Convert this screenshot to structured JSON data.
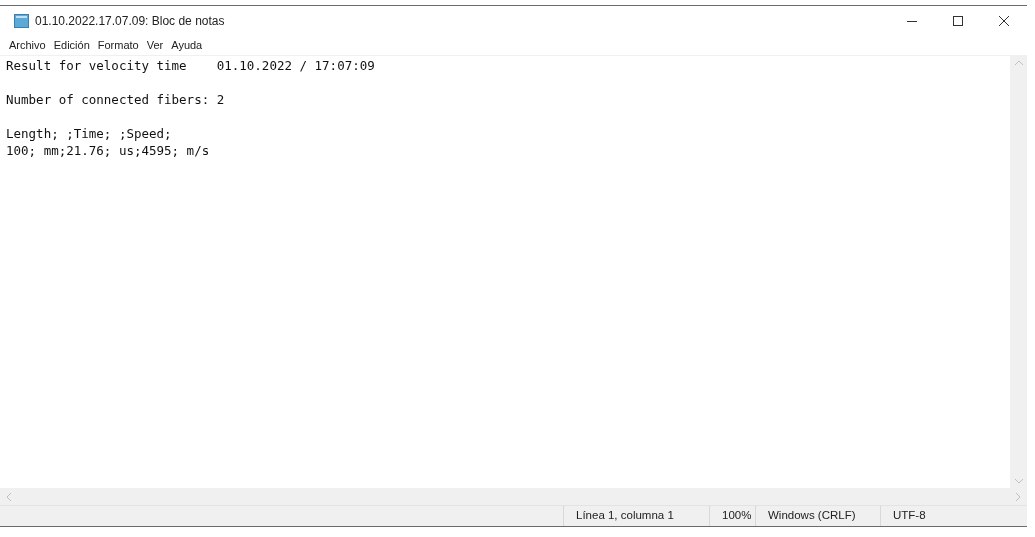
{
  "window": {
    "title": "01.10.2022.17.07.09: Bloc de notas"
  },
  "menu": [
    "Archivo",
    "Edición",
    "Formato",
    "Ver",
    "Ayuda"
  ],
  "document": {
    "paragraphs": [
      [
        "Result for velocity time    01.10.2022 / 17:07:09"
      ],
      [
        "Number of connected fibers: 2"
      ],
      [
        "Length; ;Time; ;Speed;",
        "100; mm;21.76; us;4595; m/s"
      ]
    ]
  },
  "status_bar": [
    "Línea 1, columna 1",
    "100%",
    "Windows (CRLF)",
    "UTF-8"
  ]
}
